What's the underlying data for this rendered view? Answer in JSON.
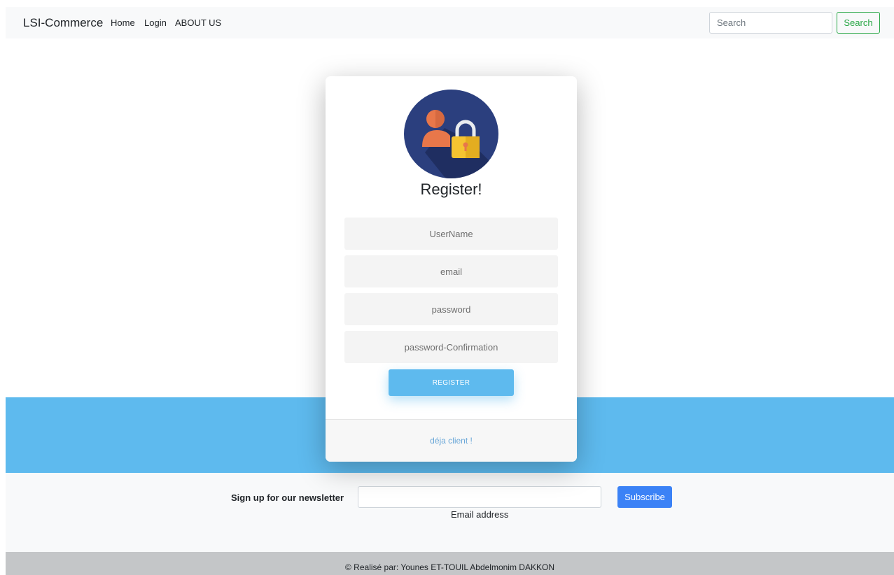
{
  "navbar": {
    "brand": "LSI-Commerce",
    "links": [
      "Home",
      "Login",
      "ABOUT US"
    ],
    "search_placeholder": "Search",
    "search_button": "Search"
  },
  "register": {
    "title": "Register!",
    "fields": [
      {
        "placeholder": "UserName"
      },
      {
        "placeholder": "email"
      },
      {
        "placeholder": "password"
      },
      {
        "placeholder": "password-Confirmation"
      }
    ],
    "button": "REGISTER",
    "footer_link": "déja client !"
  },
  "newsletter": {
    "label": "Sign up for our newsletter",
    "input_value": "",
    "help_text": "Email address",
    "button": "Subscribe"
  },
  "footer": {
    "credit": "© Realisé par: Younes ET-TOUIL Abdelmonim DAKKON"
  },
  "colors": {
    "accent": "#5ebaee",
    "success": "#28a745",
    "subscribe": "#3b82f6",
    "navbar_bg": "#f8f9fa",
    "footer_bg": "#c4c6c8"
  },
  "icons": {
    "avatar": "user-lock-icon"
  }
}
